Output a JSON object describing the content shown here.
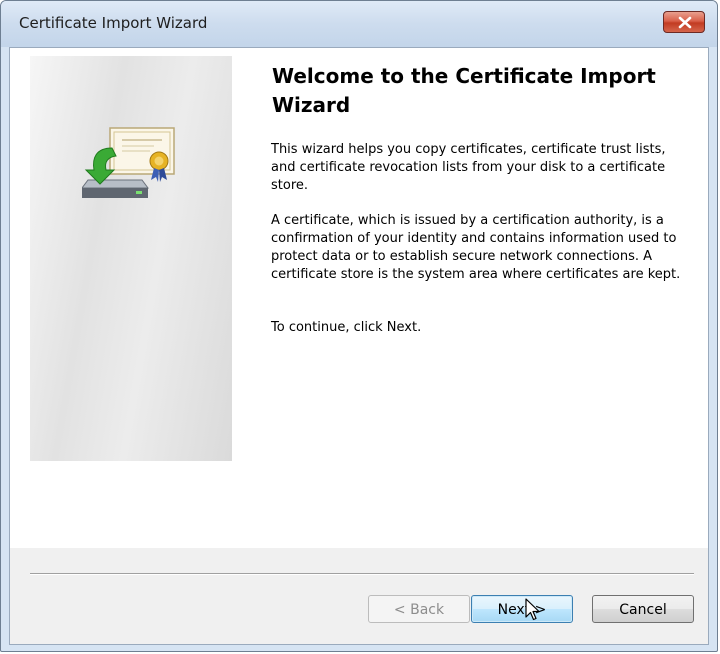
{
  "window": {
    "title": "Certificate Import Wizard"
  },
  "wizard": {
    "heading": "Welcome to the Certificate Import Wizard",
    "paragraphs": [
      "This wizard helps you copy certificates, certificate trust lists, and certificate revocation lists from your disk to a certificate store.",
      "A certificate, which is issued by a certification authority, is a confirmation of your identity and contains information used to protect data or to establish secure network connections. A certificate store is the system area where certificates are kept.",
      "To continue, click Next."
    ]
  },
  "buttons": {
    "back_label": "< Back",
    "next_label": "Next >",
    "cancel_label": "Cancel"
  },
  "icons": {
    "close": "close-icon",
    "wizard": "certificate-install-icon",
    "cursor": "mouse-pointer-icon"
  },
  "colors": {
    "close_button": "#c23b22",
    "next_button_border": "#3c7fb1",
    "disabled_text": "#8d8d8d"
  }
}
